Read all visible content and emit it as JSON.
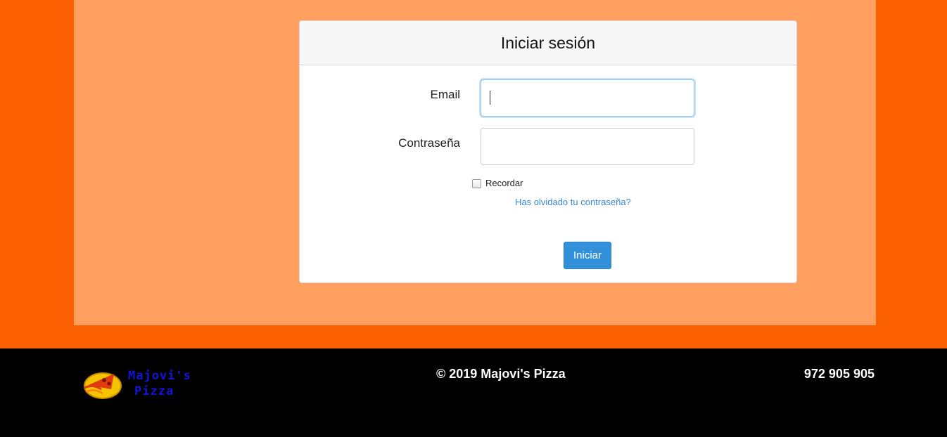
{
  "login": {
    "title": "Iniciar sesión",
    "email_label": "Email",
    "email_value": "",
    "password_label": "Contraseña",
    "password_value": "",
    "remember_label": "Recordar",
    "remember_checked": false,
    "forgot_link": "Has olvidado tu contraseña?",
    "submit_label": "Iniciar"
  },
  "footer": {
    "logo_line1": "Majovi's",
    "logo_line2": "Pizza",
    "copyright": "© 2019 Majovi's Pizza",
    "phone": "972 905 905"
  },
  "colors": {
    "page_background": "#fa5f01",
    "content_background": "#ffa061",
    "footer_background": "#000000",
    "primary_button": "#3291d9",
    "link": "#3a86d0",
    "logo_text": "#1414d8"
  },
  "icons": {
    "logo": "pizza-slice-logo-icon"
  }
}
